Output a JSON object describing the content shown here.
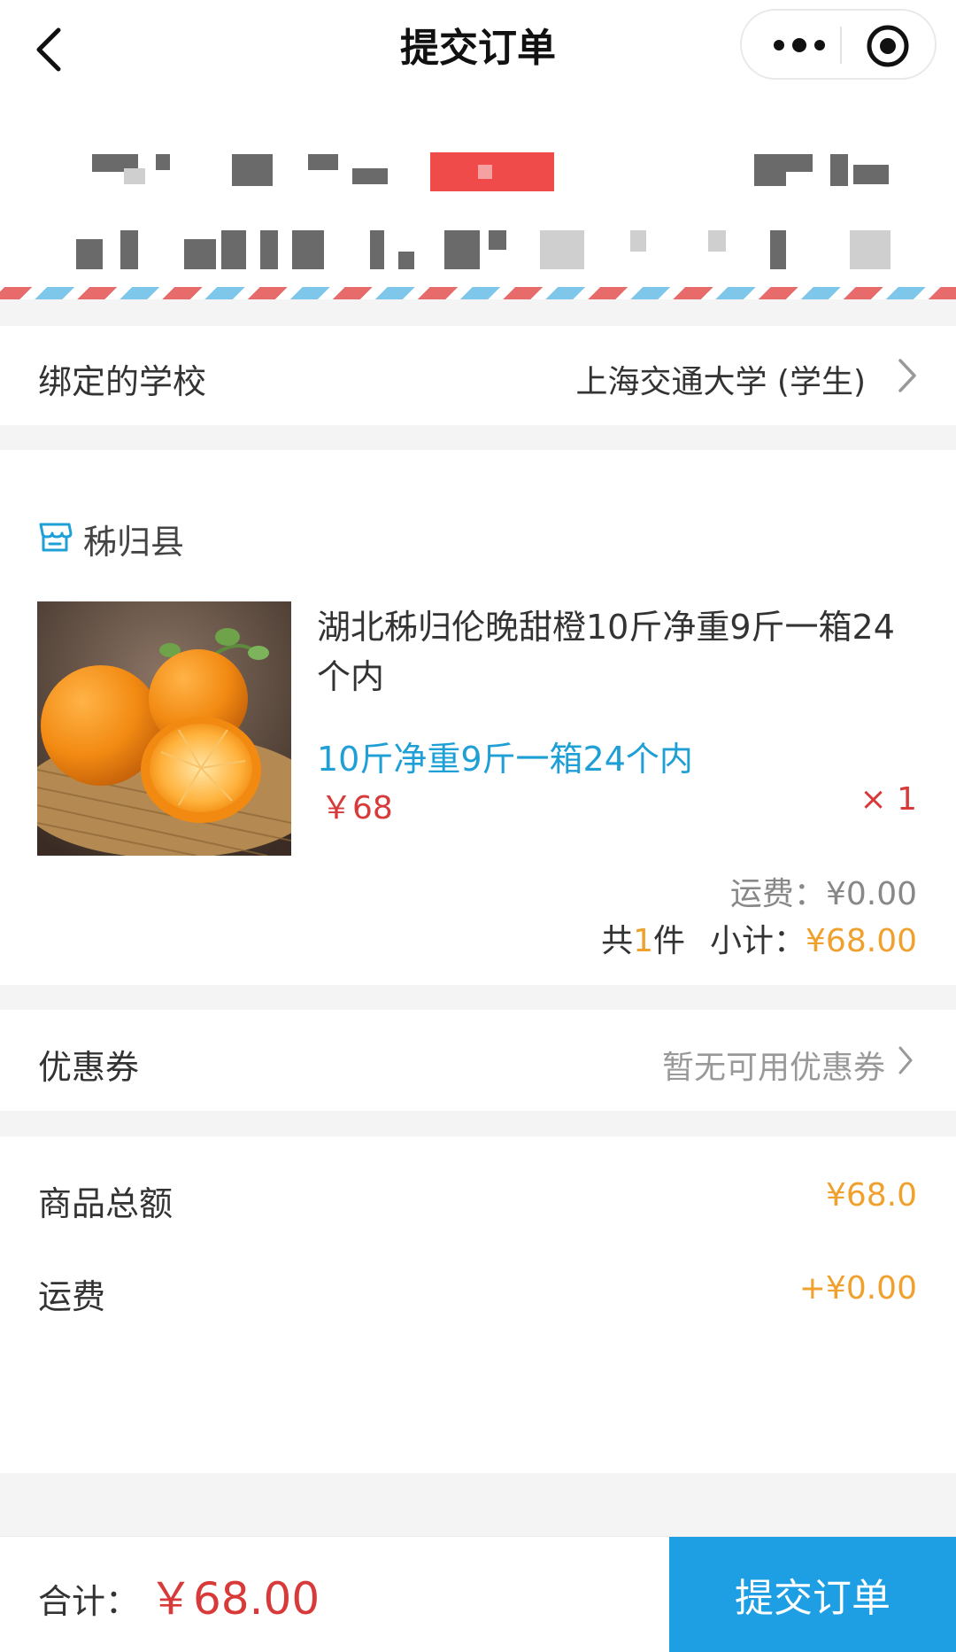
{
  "nav": {
    "title": "提交订单",
    "back_icon": "chevron-left-icon",
    "more_icon": "more-dots-icon",
    "close_icon": "target-circle-icon"
  },
  "address": {
    "status": "blurred"
  },
  "school": {
    "label": "绑定的学校",
    "value": "上海交通大学 (学生)"
  },
  "shop": {
    "store_name": "秭归县",
    "product_name": "湖北秭归伦晚甜橙10斤净重9斤一箱24个内",
    "spec": "10斤净重9斤一箱24个内",
    "price": "￥68",
    "qty": "× 1",
    "freight_label": "运费：",
    "freight_value": "¥0.00",
    "count_prefix": "共",
    "count": "1",
    "count_suffix": "件",
    "subtotal_label": "小计：",
    "subtotal_value": "¥68.00"
  },
  "coupon": {
    "label": "优惠券",
    "value": "暂无可用优惠券"
  },
  "summary": {
    "goods_total_label": "商品总额",
    "goods_total_value": "¥68.0",
    "shipping_label": "运费",
    "shipping_value": "+¥0.00"
  },
  "footer": {
    "total_label": "合计：",
    "total_value": "￥68.00",
    "submit_label": "提交订单"
  },
  "colors": {
    "accent_blue": "#1f9fe3",
    "price_red": "#d83a3a",
    "amount_orange": "#f0a12d",
    "spec_blue": "#1e9fd6"
  }
}
